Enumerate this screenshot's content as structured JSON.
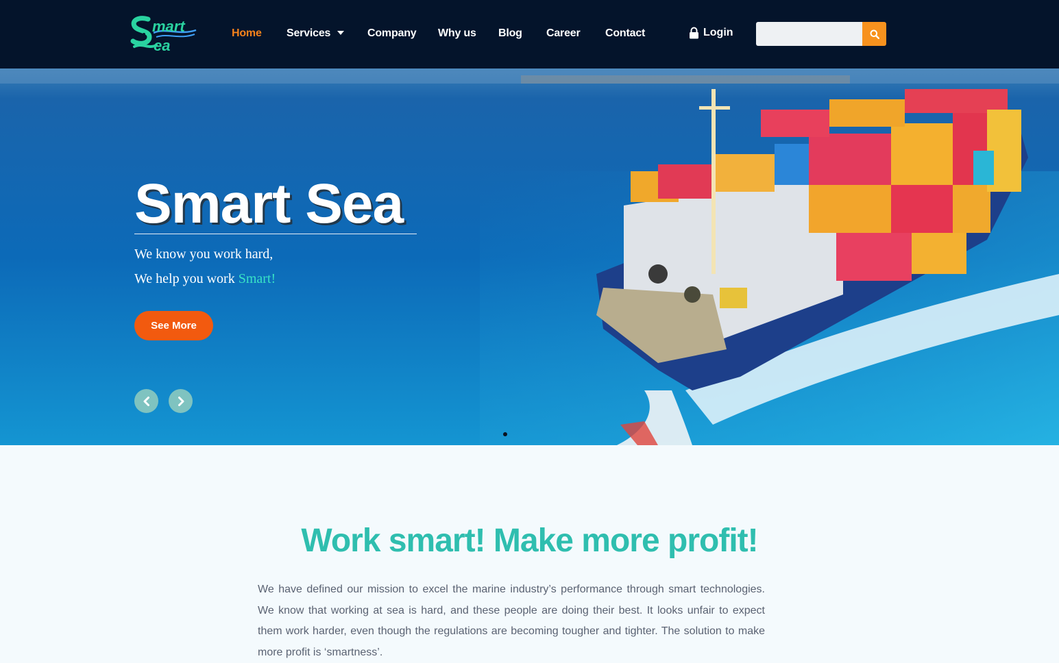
{
  "brand": {
    "logo_text_line1": "mart",
    "logo_text_line2": "ea",
    "logo_initial": "S"
  },
  "nav": {
    "home": "Home",
    "services": "Services",
    "company": "Company",
    "why_us": "Why us",
    "blog": "Blog",
    "career": "Career",
    "contact": "Contact",
    "login": "Login"
  },
  "search": {
    "placeholder": ""
  },
  "hero": {
    "title": "Smart Sea",
    "line1": "We know you work hard,",
    "line2_prefix": "We help you work ",
    "line2_accent": "Smart!",
    "cta": "See More"
  },
  "section": {
    "heading": "Work smart! Make more profit!",
    "paragraph": "We have defined our mission to excel the marine industry’s performance through smart technologies. We know that working at sea is hard, and these people are doing their best. It looks unfair to expect them work harder, even though the regulations are becoming tougher and tighter. The solution to make more profit is ‘smartness’."
  },
  "colors": {
    "header_bg": "#04142b",
    "nav_active": "#f7821b",
    "search_button": "#f7921e",
    "cta_button": "#f25a0f",
    "accent_teal": "#2fbeaf",
    "hero_accent": "#38e3c6"
  },
  "icons": {
    "login": "lock-icon",
    "search": "search-icon",
    "services_dropdown": "caret-down-icon",
    "slider_prev": "chevron-left-icon",
    "slider_next": "chevron-right-icon"
  }
}
